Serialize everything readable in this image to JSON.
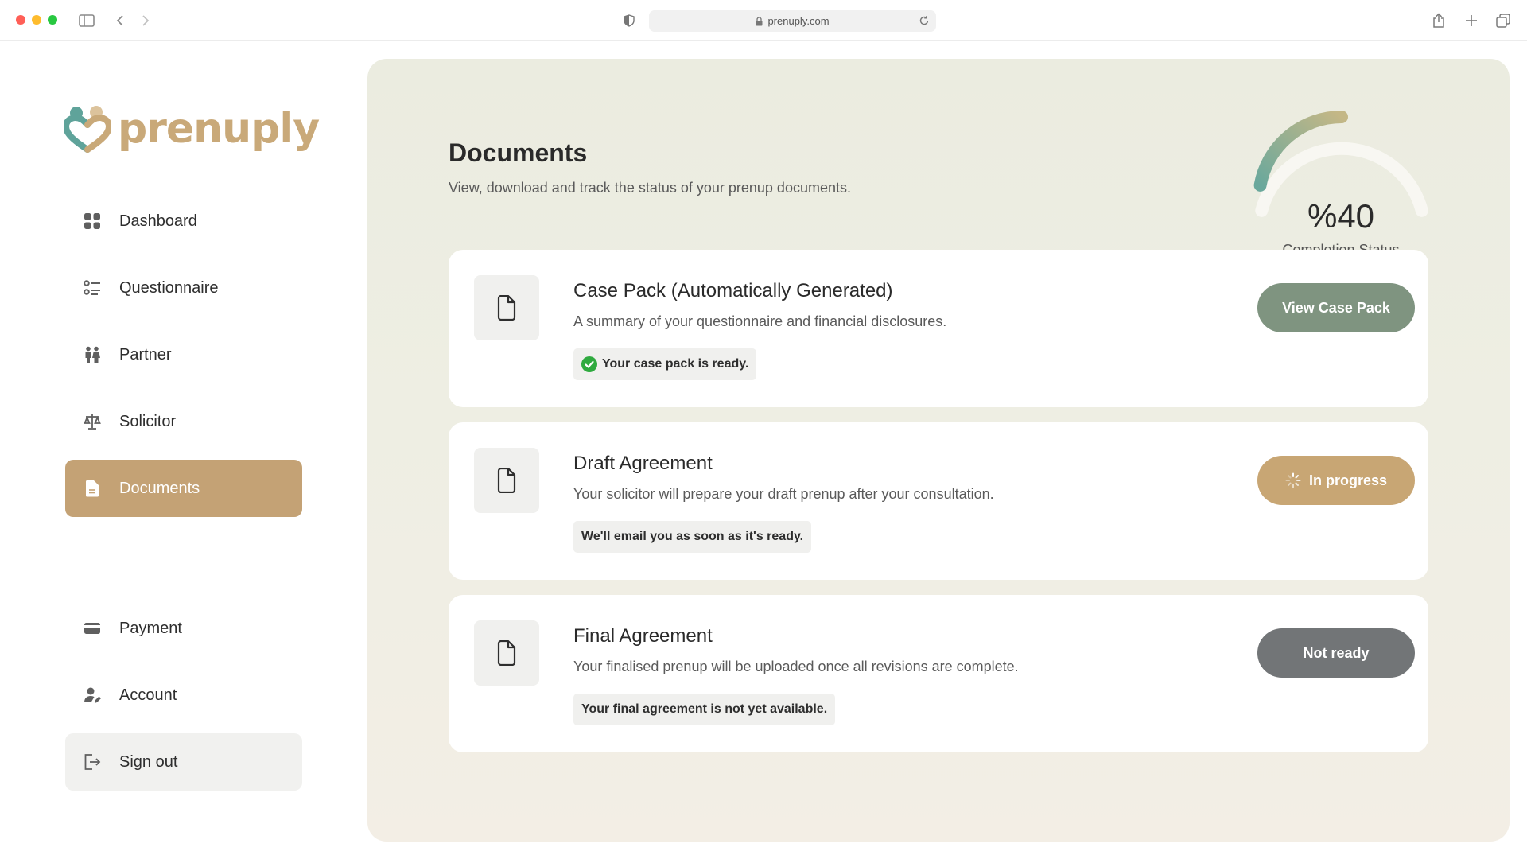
{
  "browser": {
    "url": "prenuply.com"
  },
  "brand": {
    "name": "prenuply",
    "accent": "#c4a275",
    "teal": "#5fa39a"
  },
  "sidebar": {
    "items": [
      {
        "label": "Dashboard",
        "icon": "grid-icon"
      },
      {
        "label": "Questionnaire",
        "icon": "list-icon"
      },
      {
        "label": "Partner",
        "icon": "people-icon"
      },
      {
        "label": "Solicitor",
        "icon": "scales-icon"
      },
      {
        "label": "Documents",
        "icon": "document-icon",
        "active": true
      }
    ],
    "bottom_items": [
      {
        "label": "Payment",
        "icon": "credit-card-icon"
      },
      {
        "label": "Account",
        "icon": "user-edit-icon"
      },
      {
        "label": "Sign out",
        "icon": "sign-out-icon"
      }
    ]
  },
  "page": {
    "title": "Documents",
    "subtitle": "View, download and track the status of your prenup documents."
  },
  "completion": {
    "value_text": "%40",
    "percent": 40,
    "label": "Completion Status"
  },
  "documents": [
    {
      "title": "Case Pack (Automatically Generated)",
      "description": "A summary of your questionnaire and financial disclosures.",
      "status": "Your case pack is ready.",
      "button": "View Case Pack",
      "button_color": "#7f9480"
    },
    {
      "title": "Draft Agreement",
      "description": "Your solicitor will prepare your draft prenup after your consultation.",
      "status": "We'll email you as soon as it's ready.",
      "button": "In progress",
      "button_color": "#c8a674"
    },
    {
      "title": "Final Agreement",
      "description": "Your finalised prenup will be uploaded once all revisions are complete.",
      "status": "Your final agreement is not yet available.",
      "button": "Not ready",
      "button_color": "#727577"
    }
  ]
}
